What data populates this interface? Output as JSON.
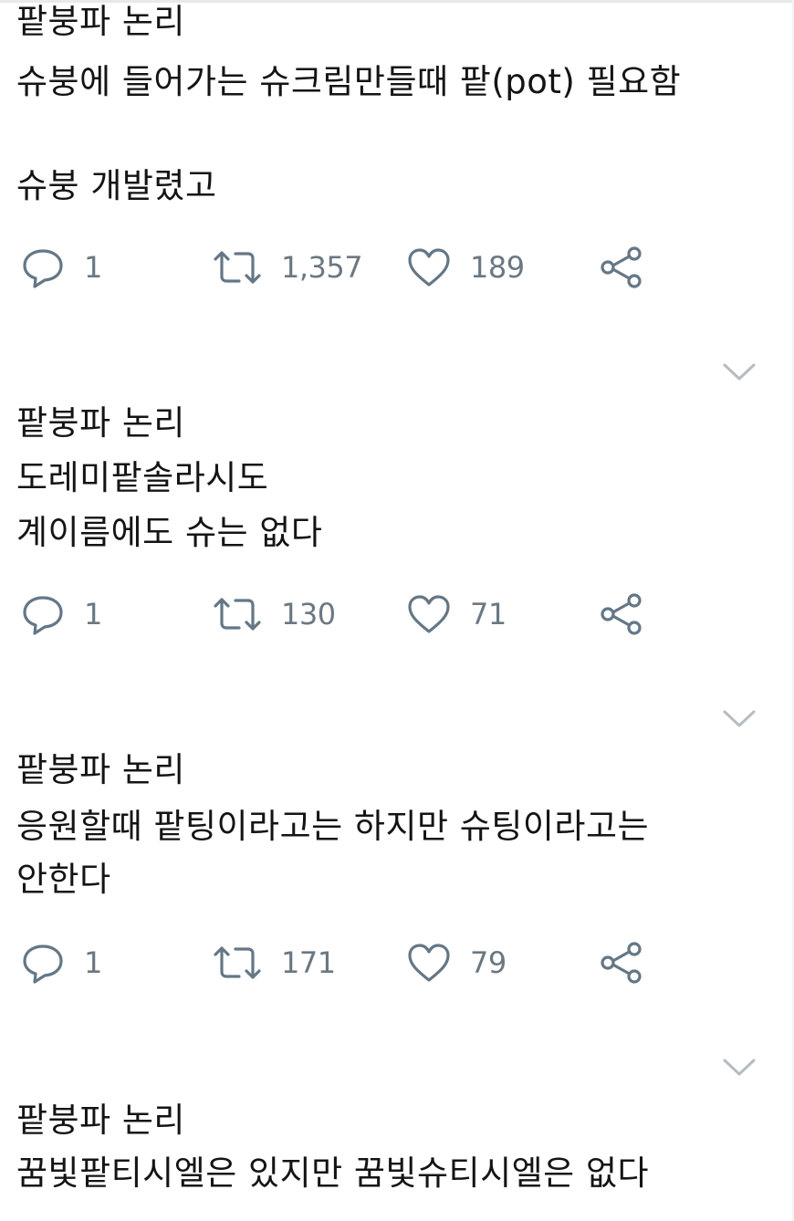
{
  "tweets": [
    {
      "lines": [
        "팥붕파 논리",
        "슈붕에 들어가는 슈크림만들때 팥(pot) 필요함",
        "",
        "슈붕 개발렸고"
      ],
      "reply_count": "1",
      "retweet_count": "1,357",
      "like_count": "189"
    },
    {
      "lines": [
        "팥붕파 논리",
        "도레미팥솔라시도",
        "계이름에도 슈는 없다"
      ],
      "reply_count": "1",
      "retweet_count": "130",
      "like_count": "71"
    },
    {
      "lines": [
        "팥붕파 논리",
        "응원할때 팥팅이라고는 하지만 슈팅이라고는",
        "안한다"
      ],
      "reply_count": "1",
      "retweet_count": "171",
      "like_count": "79"
    },
    {
      "lines": [
        "팥붕파 논리",
        "꿈빛팥티시엘은 있지만 꿈빛슈티시엘은 없다"
      ]
    }
  ],
  "icons": {
    "reply": "reply-bubble-icon",
    "retweet": "retweet-icon",
    "like": "heart-icon",
    "share": "share-icon",
    "more": "chevron-down-icon"
  },
  "colors": {
    "text": "#141414",
    "icon": "#657786",
    "count": "#6b7882",
    "chevron": "#b5bcc2"
  }
}
